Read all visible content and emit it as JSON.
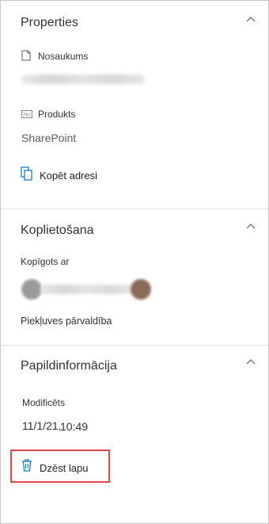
{
  "properties": {
    "title": "Properties",
    "name_label": "Nosaukums",
    "product_label": "Produkts",
    "product_value": "SharePoint",
    "copy_address_label": "Kopēt adresi"
  },
  "sharing": {
    "title": "Koplietošana",
    "shared_with_label": "Kopīgots ar",
    "access_management_label": "Piekļuves pārvaldība"
  },
  "details": {
    "title": "Papildinformācija",
    "modified_label": "Modificēts",
    "modified_date": "11/1/21,",
    "modified_time": "10:49"
  },
  "actions": {
    "delete_label": "Dzēst lapu"
  },
  "colors": {
    "accent": "#0078d4",
    "highlight": "#e3464c"
  }
}
